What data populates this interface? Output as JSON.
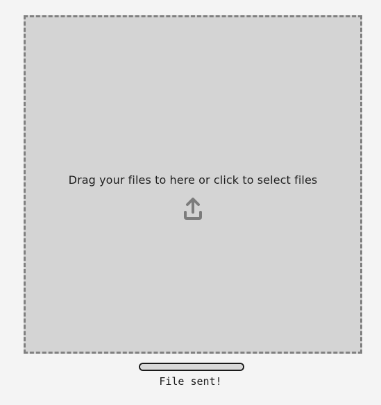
{
  "dropzone": {
    "prompt": "Drag your files to here or click to select files",
    "icon": "upload-icon",
    "background": "#d4d4d4",
    "border_color": "#808080"
  },
  "upload": {
    "progress_percent": 100,
    "status_text": "File sent!"
  }
}
